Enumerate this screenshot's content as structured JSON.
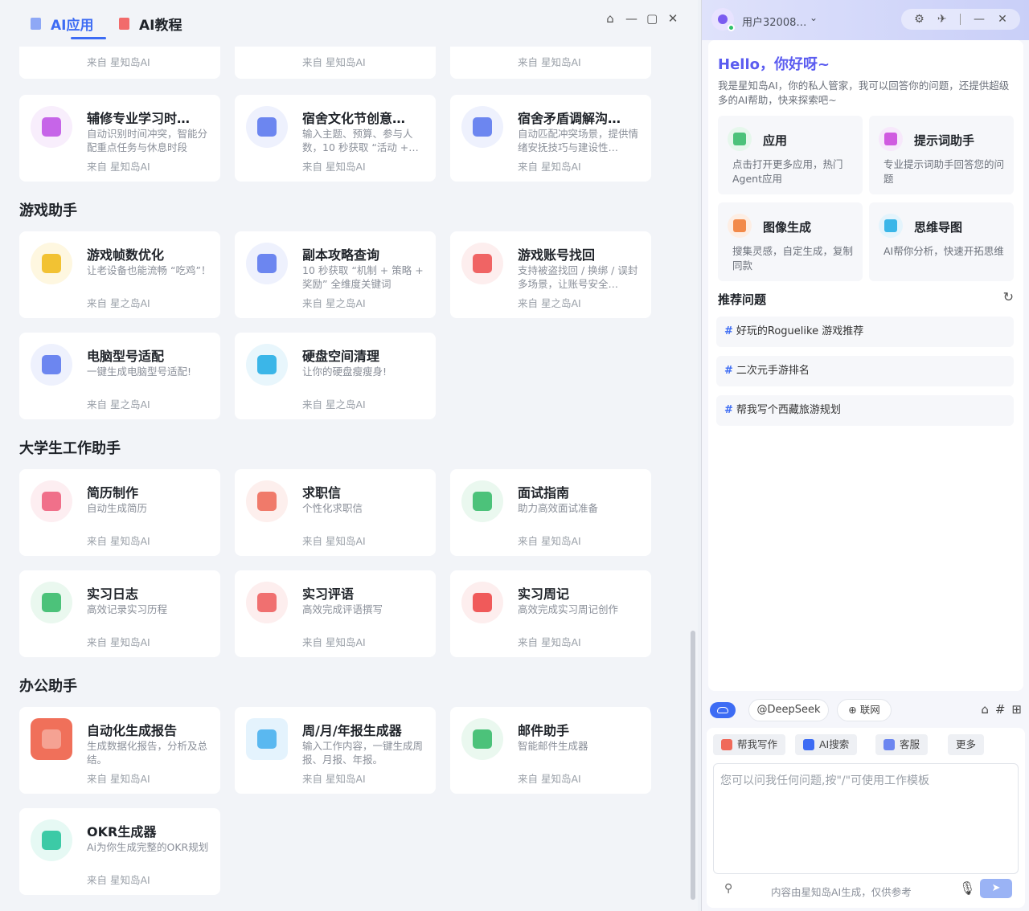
{
  "tabs": [
    {
      "label": "AI应用",
      "active": true
    },
    {
      "label": "AI教程",
      "active": false
    }
  ],
  "window_controls": {
    "home": "⌂",
    "minimize": "—",
    "maximize": "▢",
    "close": "✕"
  },
  "top_cards": [
    {
      "title": "",
      "desc": "",
      "source": "来自 星知岛AI"
    },
    {
      "title": "",
      "desc": "",
      "source": "来自 星知岛AI"
    },
    {
      "title": "",
      "desc": "",
      "source": "来自 星知岛AI"
    }
  ],
  "study_cards": [
    {
      "title": "辅修专业学习时…",
      "desc": "自动识别时间冲突，智能分配重点任务与休息时段",
      "source": "来自 星知岛AI",
      "icon": "calendar-icon",
      "color": "#c665e8",
      "bg": "#f8eefc"
    },
    {
      "title": "宿舍文化节创意…",
      "desc": "输入主题、预算、参与人数，10 秒获取 “活动 +…",
      "source": "来自 星知岛AI",
      "icon": "document-icon",
      "color": "#6c86f0",
      "bg": "#eef1fd"
    },
    {
      "title": "宿舍矛盾调解沟…",
      "desc": "自动匹配冲突场景，提供情绪安抚技巧与建设性…",
      "source": "来自 星知岛AI",
      "icon": "document-icon",
      "color": "#6c86f0",
      "bg": "#eef1fd"
    }
  ],
  "sections": [
    {
      "title": "游戏助手",
      "cards": [
        {
          "title": "游戏帧数优化",
          "desc": "让老设备也能流畅 “吃鸡”！",
          "source": "来自 星之岛AI",
          "icon": "keyboard-icon",
          "color": "#f2c233",
          "bg": "#fef7e0"
        },
        {
          "title": "副本攻略查询",
          "desc": "10 秒获取 “机制 + 策略 + 奖励” 全维度关键词",
          "source": "来自 星之岛AI",
          "icon": "document-icon",
          "color": "#6c86f0",
          "bg": "#eef1fd"
        },
        {
          "title": "游戏账号找回",
          "desc": "支持被盗找回 / 换绑 / 误封多场景，让账号安全…",
          "source": "来自 星之岛AI",
          "icon": "user-card-icon",
          "color": "#f06464",
          "bg": "#fdeeee"
        },
        {
          "title": "电脑型号适配",
          "desc": "一键生成电脑型号适配!",
          "source": "来自 星之岛AI",
          "icon": "document-icon",
          "color": "#6c86f0",
          "bg": "#eef1fd"
        },
        {
          "title": "硬盘空间清理",
          "desc": "让你的硬盘瘦瘦身!",
          "source": "来自 星之岛AI",
          "icon": "parking-icon",
          "color": "#3bb6e8",
          "bg": "#e8f6fc"
        }
      ]
    },
    {
      "title": "大学生工作助手",
      "cards": [
        {
          "title": "简历制作",
          "desc": "自动生成简历",
          "source": "来自 星知岛AI",
          "icon": "edit-doc-icon",
          "color": "#f0708a",
          "bg": "#fdeef1"
        },
        {
          "title": "求职信",
          "desc": "个性化求职信",
          "source": "来自 星知岛AI",
          "icon": "letter-icon",
          "color": "#f07a6a",
          "bg": "#fdefed"
        },
        {
          "title": "面试指南",
          "desc": "助力高效面试准备",
          "source": "来自 星知岛AI",
          "icon": "person-icon",
          "color": "#4cc27a",
          "bg": "#eaf8ef"
        },
        {
          "title": "实习日志",
          "desc": "高效记录实习历程",
          "source": "来自 星知岛AI",
          "icon": "log-icon",
          "color": "#4cc27a",
          "bg": "#eaf8ef"
        },
        {
          "title": "实习评语",
          "desc": "高效完成评语撰写",
          "source": "来自 星知岛AI",
          "icon": "text-icon",
          "color": "#f07070",
          "bg": "#fdeeee"
        },
        {
          "title": "实习周记",
          "desc": "高效完成实习周记创作",
          "source": "来自 星知岛AI",
          "icon": "heart-book-icon",
          "color": "#f05a5a",
          "bg": "#fdeeee"
        }
      ]
    },
    {
      "title": "办公助手",
      "cards": [
        {
          "title": "自动化生成报告",
          "desc": "生成数据化报告，分析及总结。",
          "source": "来自 星知岛AI",
          "icon": "presentation-icon",
          "color": "#f0705a",
          "bg": "#f0705a",
          "square": true
        },
        {
          "title": "周/月/年报生成器",
          "desc": "输入工作内容，一键生成周报、月报、年报。",
          "source": "来自 星知岛AI",
          "icon": "report-icon",
          "color": "#5ab8f0",
          "bg": "#e4f3fd",
          "square": true
        },
        {
          "title": "邮件助手",
          "desc": "智能邮件生成器",
          "source": "来自 星知岛AI",
          "icon": "mail-book-icon",
          "color": "#4cc27a",
          "bg": "#eaf8ef"
        },
        {
          "title": "OKR生成器",
          "desc": "Ai为你生成完整的OKR规划",
          "source": "来自 星知岛AI",
          "icon": "okr-icon",
          "color": "#3ccaa6",
          "bg": "#e6f9f4"
        }
      ]
    }
  ],
  "right": {
    "user": "用户32008…",
    "tools": [
      "⚙",
      "✈",
      "|",
      "—",
      "✕"
    ],
    "hello": "Hello，你好呀~",
    "intro": "我是星知岛AI，你的私人管家，我可以回答你的问题，还提供超级多的AI帮助，快来探索吧~",
    "features": [
      {
        "title": "应用",
        "desc": "点击打开更多应用，热门Agent应用",
        "icon": "apps-icon",
        "color": "#4cc27a",
        "bg": "#e6f7ec"
      },
      {
        "title": "提示词助手",
        "desc": "专业提示词助手回答您的问题",
        "icon": "robot-icon",
        "color": "#d05ae0",
        "bg": "#f7e8fb"
      },
      {
        "title": "图像生成",
        "desc": "搜集灵感，自定生成，复制同款",
        "icon": "image-icon",
        "color": "#f28a4a",
        "bg": "#fdeee4"
      },
      {
        "title": "思维导图",
        "desc": "AI帮你分析，快速开拓思维",
        "icon": "mindmap-icon",
        "color": "#3bb6e8",
        "bg": "#e4f4fc"
      }
    ],
    "rec_title": "推荐问题",
    "questions": [
      "好玩的Roguelike 游戏推荐",
      "二次元手游排名",
      "帮我写个西藏旅游规划"
    ],
    "toolbar": {
      "model": "@DeepSeek",
      "web": "⊕ 联网"
    },
    "chips": [
      {
        "label": "帮我写作",
        "color": "#f06a5a"
      },
      {
        "label": "AI搜索",
        "color": "#3d6cf4"
      },
      {
        "label": "客服",
        "color": "#6c86f0"
      },
      {
        "label": "更多",
        "color": ""
      }
    ],
    "placeholder": "您可以问我任何问题,按\"/\"可使用工作模板",
    "disclaimer": "内容由星知岛AI生成，仅供参考"
  }
}
